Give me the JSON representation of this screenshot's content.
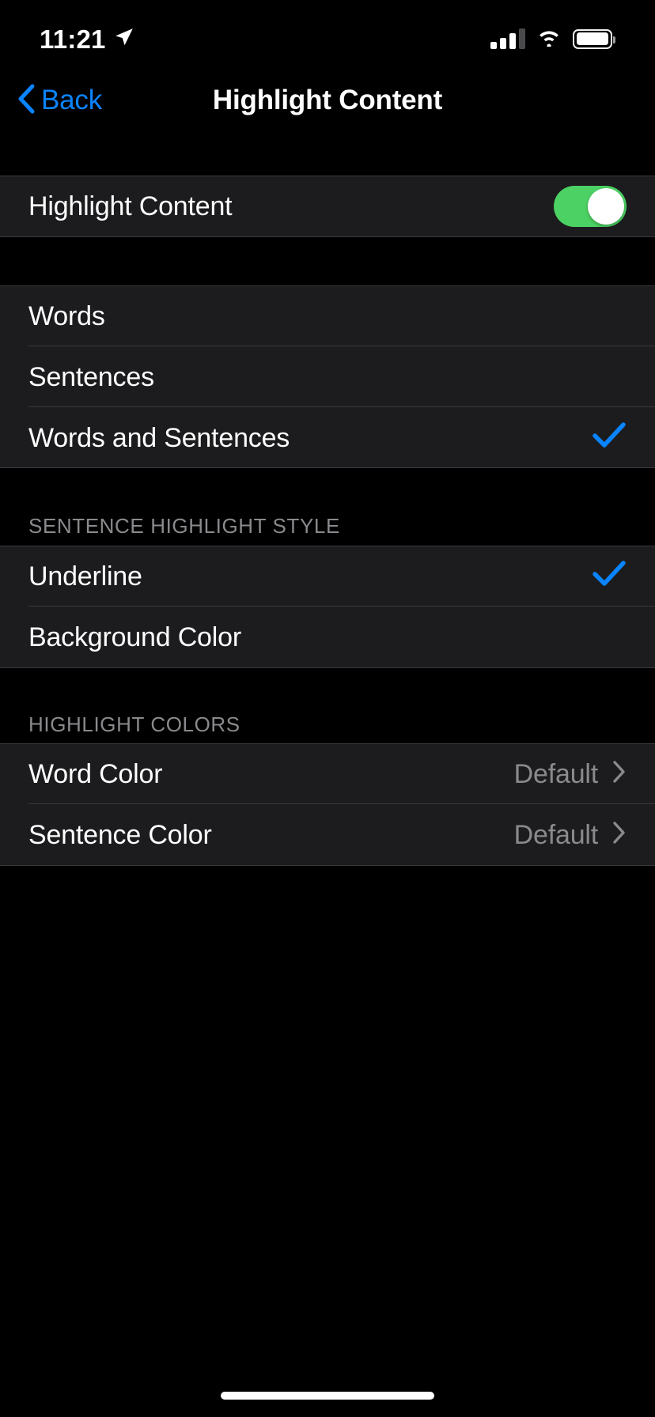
{
  "status_bar": {
    "time": "11:21",
    "location_icon": "location-arrow-icon",
    "cellular_icon": "cellular-signal-icon",
    "signal_bars_filled": 3,
    "signal_bars_total": 4,
    "wifi_icon": "wifi-icon",
    "battery_icon": "battery-icon",
    "battery_level_percent": 85
  },
  "nav": {
    "back_label": "Back",
    "back_icon": "chevron-left-icon",
    "title": "Highlight Content"
  },
  "sections": {
    "toggle_section": {
      "label": "Highlight Content",
      "toggle_on": true
    },
    "highlight_mode": {
      "options": [
        {
          "label": "Words",
          "selected": false
        },
        {
          "label": "Sentences",
          "selected": false
        },
        {
          "label": "Words and Sentences",
          "selected": true
        }
      ]
    },
    "sentence_highlight_style": {
      "header": "Sentence Highlight Style",
      "options": [
        {
          "label": "Underline",
          "selected": true
        },
        {
          "label": "Background Color",
          "selected": false
        }
      ]
    },
    "highlight_colors": {
      "header": "Highlight Colors",
      "rows": [
        {
          "label": "Word Color",
          "value": "Default"
        },
        {
          "label": "Sentence Color",
          "value": "Default"
        }
      ]
    }
  },
  "colors": {
    "accent_blue": "#0A84FF",
    "toggle_green": "#4CD264",
    "row_background": "#1C1C1E",
    "page_background": "#000000",
    "secondary_text": "#8A8A8E",
    "separator": "#3A3A3C"
  }
}
